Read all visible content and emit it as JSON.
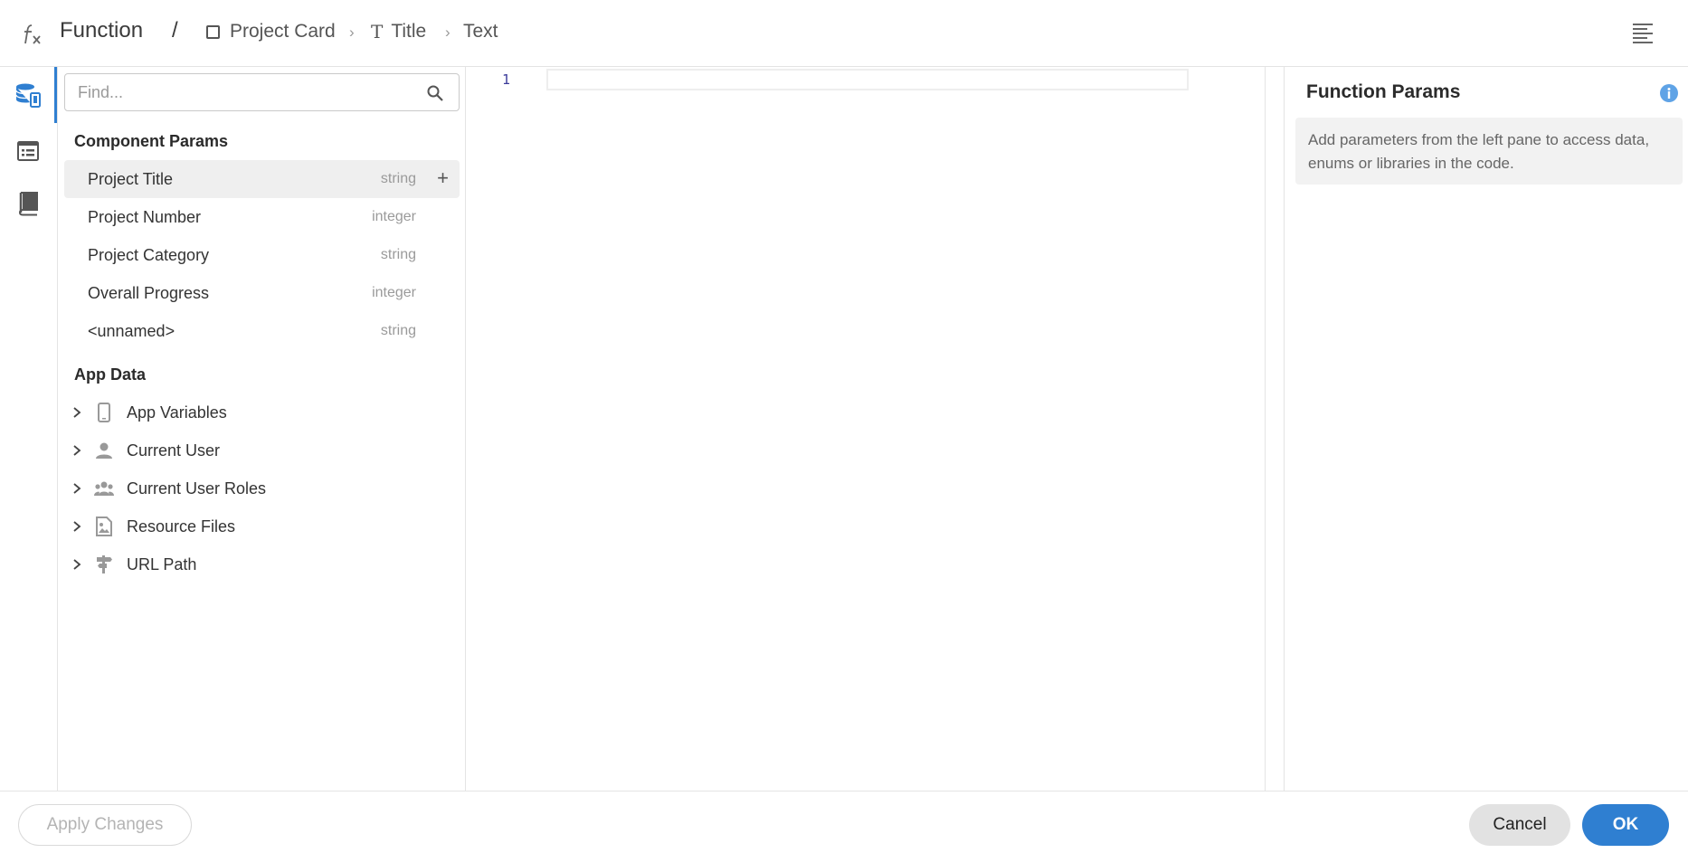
{
  "header": {
    "title": "Function",
    "separator": "/",
    "breadcrumbs": [
      {
        "label": "Project Card",
        "icon": "square-icon"
      },
      {
        "label": "Title",
        "icon": "text-type-icon"
      },
      {
        "label": "Text",
        "icon": ""
      }
    ],
    "breadcrumb_separator": "›"
  },
  "rail": {
    "items": [
      {
        "name": "data-sources-icon",
        "active": true
      },
      {
        "name": "list-view-icon",
        "active": false
      },
      {
        "name": "library-icon",
        "active": false
      }
    ]
  },
  "search": {
    "placeholder": "Find...",
    "value": ""
  },
  "component_params": {
    "title": "Component Params",
    "items": [
      {
        "name": "Project Title",
        "type": "string",
        "selected": true
      },
      {
        "name": "Project Number",
        "type": "integer",
        "selected": false
      },
      {
        "name": "Project Category",
        "type": "string",
        "selected": false
      },
      {
        "name": "Overall Progress",
        "type": "integer",
        "selected": false
      },
      {
        "name": "<unnamed>",
        "type": "string",
        "selected": false
      }
    ],
    "add_symbol": "+"
  },
  "app_data": {
    "title": "App Data",
    "items": [
      {
        "label": "App Variables",
        "icon": "phone-icon"
      },
      {
        "label": "Current User",
        "icon": "person-icon"
      },
      {
        "label": "Current User Roles",
        "icon": "people-icon"
      },
      {
        "label": "Resource Files",
        "icon": "image-file-icon"
      },
      {
        "label": "URL Path",
        "icon": "signpost-icon"
      }
    ]
  },
  "editor": {
    "line_numbers": [
      "1"
    ],
    "code": ""
  },
  "function_params": {
    "title": "Function Params",
    "hint": "Add parameters from the left pane to access data, enums or libraries in the code."
  },
  "footer": {
    "apply_label": "Apply Changes",
    "cancel_label": "Cancel",
    "ok_label": "OK"
  },
  "colors": {
    "accent": "#2f7fd1",
    "selected_row": "#efefef",
    "muted_text": "#9a9a9a"
  }
}
